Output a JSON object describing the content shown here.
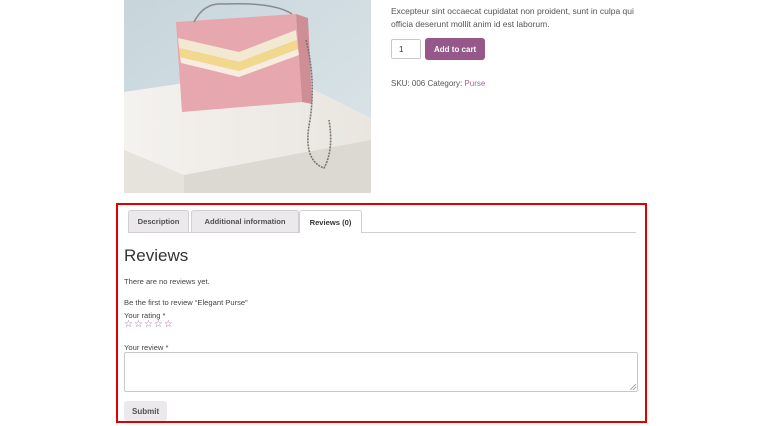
{
  "product": {
    "description_text": "Excepteur sint occaecat cupidatat non proident, sunt in culpa qui officia deserunt mollit anim id est laborum.",
    "quantity": "1",
    "add_to_cart_label": "Add to cart",
    "sku_label": "SKU:",
    "sku_value": "006",
    "category_label": "Category:",
    "category_value": "Purse"
  },
  "tabs": [
    {
      "label": "Description"
    },
    {
      "label": "Additional information"
    },
    {
      "label": "Reviews (0)"
    }
  ],
  "reviews": {
    "title": "Reviews",
    "no_reviews_text": "There are no reviews yet.",
    "first_review_prompt": "Be the first to review “Elegant Purse”",
    "rating_label": "Your rating *",
    "review_label": "Your review *",
    "submit_label": "Submit"
  },
  "colors": {
    "accent": "#96588a",
    "link": "#a46497",
    "highlight_border": "#e00000"
  },
  "icons": {
    "star": "star-outline-icon"
  }
}
